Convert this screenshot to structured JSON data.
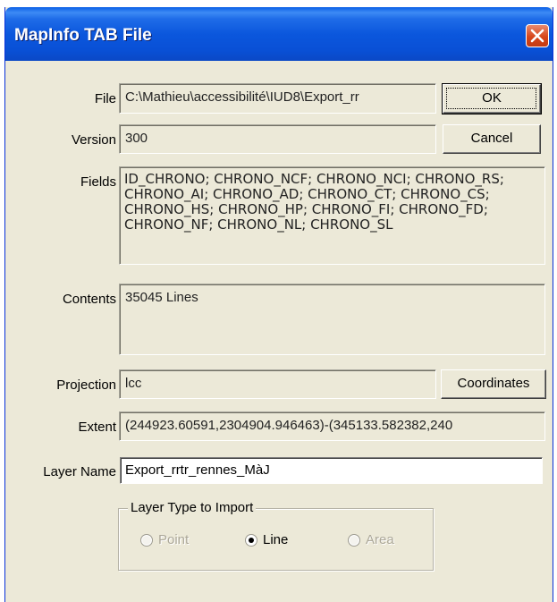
{
  "window": {
    "title": "MapInfo TAB File",
    "close_icon": "close-icon"
  },
  "labels": {
    "file": "File",
    "version": "Version",
    "fields": "Fields",
    "contents": "Contents",
    "projection": "Projection",
    "extent": "Extent",
    "layer_name": "Layer Name"
  },
  "values": {
    "file": "C:\\Mathieu\\accessibilité\\IUD8\\Export_rr",
    "version": "300",
    "fields": "ID_CHRONO; CHRONO_NCF; CHRONO_NCI; CHRONO_RS; CHRONO_AI; CHRONO_AD; CHRONO_CT; CHRONO_CS; CHRONO_HS; CHRONO_HP; CHRONO_FI; CHRONO_FD; CHRONO_NF; CHRONO_NL; CHRONO_SL",
    "contents": "35045 Lines",
    "projection": "lcc",
    "extent": "(244923.60591,2304904.946463)-(345133.582382,240",
    "layer_name": "Export_rrtr_rennes_MàJ"
  },
  "buttons": {
    "ok": "OK",
    "cancel": "Cancel",
    "coordinates": "Coordinates"
  },
  "layer_type": {
    "label": "Layer Type to Import",
    "options": [
      {
        "label": "Point",
        "selected": false,
        "enabled": false
      },
      {
        "label": "Line",
        "selected": true,
        "enabled": true
      },
      {
        "label": "Area",
        "selected": false,
        "enabled": false
      }
    ]
  }
}
